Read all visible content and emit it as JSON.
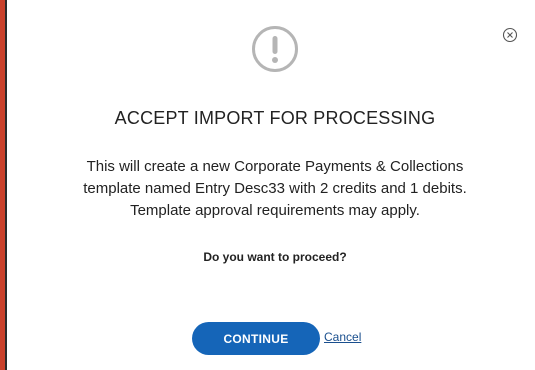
{
  "dialog": {
    "title": "ACCEPT IMPORT FOR PROCESSING",
    "message_lines": [
      "This will create a new Corporate Payments & Collections",
      "template named Entry Desc33 with 2 credits and 1 debits.",
      "Template approval requirements may apply."
    ],
    "question": "Do you want to proceed?",
    "continue_label": "CONTINUE",
    "cancel_label": "Cancel",
    "icons": {
      "warning": "exclamation-circle-icon",
      "close": "close-circle-icon"
    }
  },
  "colors": {
    "primary_button": "#1565b8",
    "link": "#1a4f8e",
    "icon_gray": "#b5b5b5",
    "left_accent": "#c9402a"
  }
}
